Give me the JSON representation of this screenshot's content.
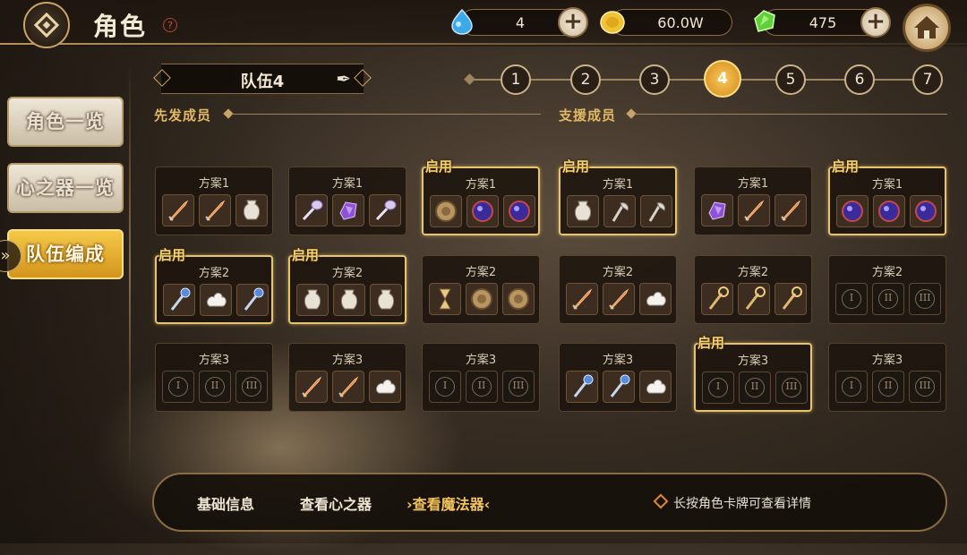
{
  "header": {
    "title": "角色",
    "help_label": "?",
    "resources": [
      {
        "name": "water-drop",
        "value": "4",
        "color": "#3fa8e6"
      },
      {
        "name": "gold-coin",
        "value": "60.0W",
        "color": "#f2c236"
      },
      {
        "name": "green-crystal",
        "value": "475",
        "color": "#5fcf3a"
      }
    ],
    "plus_label": "+"
  },
  "sidebar": {
    "items": [
      {
        "label": "角色一览",
        "active": false
      },
      {
        "label": "心之器一览",
        "active": false
      },
      {
        "label": "队伍编成",
        "active": true
      }
    ],
    "expand_label": "»"
  },
  "team": {
    "name": "队伍4",
    "edit_icon": "quill-icon"
  },
  "tabs": [
    "1",
    "2",
    "3",
    "4",
    "5",
    "6",
    "7"
  ],
  "active_tab": "4",
  "sections": {
    "starters": "先发成员",
    "support": "支援成员"
  },
  "enabled_label": "启用",
  "columns": [
    {
      "plans": [
        {
          "name": "方案1",
          "enabled": false,
          "slots": [
            "sword",
            "sword",
            "vase"
          ]
        },
        {
          "name": "方案2",
          "enabled": true,
          "slots": [
            "staff",
            "cloud",
            "staff"
          ]
        },
        {
          "name": "方案3",
          "enabled": false,
          "slots": [
            "I",
            "II",
            "III"
          ]
        }
      ]
    },
    {
      "plans": [
        {
          "name": "方案1",
          "enabled": false,
          "slots": [
            "wand",
            "purple-gem",
            "wand"
          ]
        },
        {
          "name": "方案2",
          "enabled": true,
          "slots": [
            "vase",
            "vase",
            "vase"
          ]
        },
        {
          "name": "方案3",
          "enabled": false,
          "slots": [
            "sword",
            "sword",
            "cloud"
          ]
        }
      ]
    },
    {
      "plans": [
        {
          "name": "方案1",
          "enabled": true,
          "slots": [
            "shield",
            "orb",
            "orb"
          ]
        },
        {
          "name": "方案2",
          "enabled": false,
          "slots": [
            "hourglass",
            "shield",
            "shield"
          ]
        },
        {
          "name": "方案3",
          "enabled": false,
          "slots": [
            "I",
            "II",
            "III"
          ]
        }
      ]
    },
    {
      "plans": [
        {
          "name": "方案1",
          "enabled": true,
          "slots": [
            "vase",
            "axe",
            "axe"
          ]
        },
        {
          "name": "方案2",
          "enabled": false,
          "slots": [
            "sword",
            "sword",
            "cloud"
          ]
        },
        {
          "name": "方案3",
          "enabled": false,
          "slots": [
            "staff",
            "staff",
            "cloud"
          ]
        }
      ]
    },
    {
      "plans": [
        {
          "name": "方案1",
          "enabled": false,
          "slots": [
            "purple-gem",
            "sword",
            "sword"
          ]
        },
        {
          "name": "方案2",
          "enabled": false,
          "slots": [
            "key",
            "key",
            "key"
          ]
        },
        {
          "name": "方案3",
          "enabled": true,
          "slots": [
            "I",
            "II",
            "III"
          ]
        }
      ]
    },
    {
      "plans": [
        {
          "name": "方案1",
          "enabled": true,
          "slots": [
            "orb",
            "orb",
            "orb"
          ]
        },
        {
          "name": "方案2",
          "enabled": false,
          "slots": [
            "I",
            "II",
            "III"
          ]
        },
        {
          "name": "方案3",
          "enabled": false,
          "slots": [
            "I",
            "II",
            "III"
          ]
        }
      ]
    }
  ],
  "bottom": {
    "items": [
      {
        "label": "基础信息",
        "selected": false
      },
      {
        "label": "查看心之器",
        "selected": false
      },
      {
        "label": "›查看魔法器‹",
        "selected": true
      }
    ],
    "hint": "长按角色卡牌可查看详情"
  }
}
